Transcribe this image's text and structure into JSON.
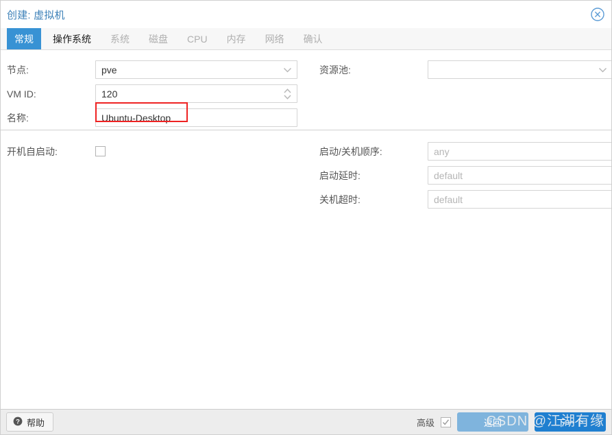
{
  "window": {
    "title": "创建: 虚拟机",
    "close_icon": "close-circle-icon"
  },
  "tabs": [
    {
      "label": "常规",
      "state": "active"
    },
    {
      "label": "操作系统",
      "state": "visited"
    },
    {
      "label": "系统",
      "state": "disabled"
    },
    {
      "label": "磁盘",
      "state": "disabled"
    },
    {
      "label": "CPU",
      "state": "disabled"
    },
    {
      "label": "内存",
      "state": "disabled"
    },
    {
      "label": "网络",
      "state": "disabled"
    },
    {
      "label": "确认",
      "state": "disabled"
    }
  ],
  "form": {
    "left": {
      "node": {
        "label": "节点:",
        "value": "pve",
        "icon": "chevron-down-icon"
      },
      "vmid": {
        "label": "VM ID:",
        "value": "120",
        "icon": "spinner-updown-icon"
      },
      "name": {
        "label": "名称:",
        "value": "Ubuntu-Desktop"
      },
      "start_at_boot": {
        "label": "开机自启动:",
        "checked": false
      }
    },
    "right": {
      "pool": {
        "label": "资源池:",
        "value": "",
        "icon": "chevron-down-icon"
      },
      "start_order": {
        "label": "启动/关机顺序:",
        "value": "",
        "placeholder": "any"
      },
      "startup_delay": {
        "label": "启动延时:",
        "value": "",
        "placeholder": "default"
      },
      "shutdown_timeout": {
        "label": "关机超时:",
        "value": "",
        "placeholder": "default"
      }
    }
  },
  "annotation": {
    "color": "#ee2222",
    "target": "name-field-value"
  },
  "footer": {
    "help_label": "帮助",
    "help_icon": "question-mark-icon",
    "advanced_label": "高级",
    "advanced_checked": true,
    "back_label": "返回",
    "next_label": "下一个"
  },
  "watermark": {
    "text": "CSDN @江湖有缘"
  },
  "colors": {
    "title": "#3d81b8",
    "tab_active_bg": "#3892d4",
    "next_button": "#1f7fd0",
    "back_button": "#7fb4dd",
    "annotation": "#ee2222"
  }
}
